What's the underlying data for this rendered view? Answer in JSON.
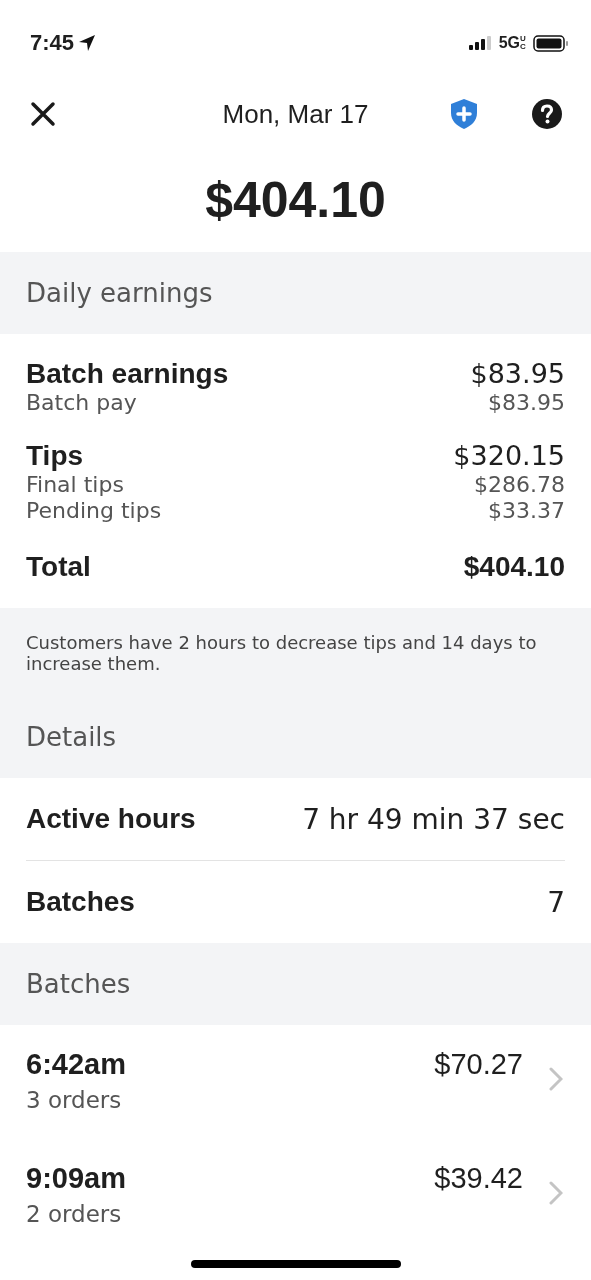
{
  "status_bar": {
    "time": "7:45",
    "network": "5G",
    "network_sub": "UC"
  },
  "header": {
    "title": "Mon, Mar 17"
  },
  "total_amount": "$404.10",
  "daily_earnings": {
    "heading": "Daily earnings",
    "groups": [
      {
        "title": "Batch earnings",
        "amount": "$83.95",
        "lines": [
          {
            "label": "Batch pay",
            "amount": "$83.95"
          }
        ]
      },
      {
        "title": "Tips",
        "amount": "$320.15",
        "lines": [
          {
            "label": "Final tips",
            "amount": "$286.78"
          },
          {
            "label": "Pending tips",
            "amount": "$33.37"
          }
        ]
      }
    ],
    "total": {
      "label": "Total",
      "amount": "$404.10"
    },
    "note": "Customers have 2 hours to decrease tips and 14 days to increase them."
  },
  "details": {
    "heading": "Details",
    "rows": [
      {
        "label": "Active hours",
        "value": "7 hr 49 min 37 sec"
      },
      {
        "label": "Batches",
        "value": "7"
      }
    ]
  },
  "batches": {
    "heading": "Batches",
    "items": [
      {
        "time": "6:42am",
        "orders": "3 orders",
        "amount": "$70.27"
      },
      {
        "time": "9:09am",
        "orders": "2 orders",
        "amount": "$39.42"
      }
    ]
  }
}
